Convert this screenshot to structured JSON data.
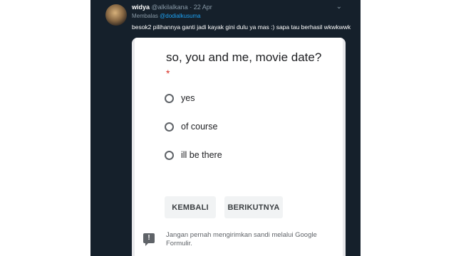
{
  "tweet": {
    "name": "widya",
    "handle": "@alkilalkana · 22 Apr",
    "reply_prefix": "Membalas",
    "reply_to": "@dodialkusuma",
    "text": "besok2 pilihannya ganti jadi kayak gini dulu ya mas :) sapa tau berhasil wkwkwwk",
    "menu_icon": "chevron-down-icon"
  },
  "form": {
    "question": "so, you and me, movie date?",
    "required_marker": "*",
    "options": [
      "yes",
      "of course",
      "ill be there"
    ],
    "back_label": "KEMBALI",
    "next_label": "BERIKUTNYA",
    "warning": "Jangan pernah mengirimkan sandi melalui Google Formulir."
  }
}
